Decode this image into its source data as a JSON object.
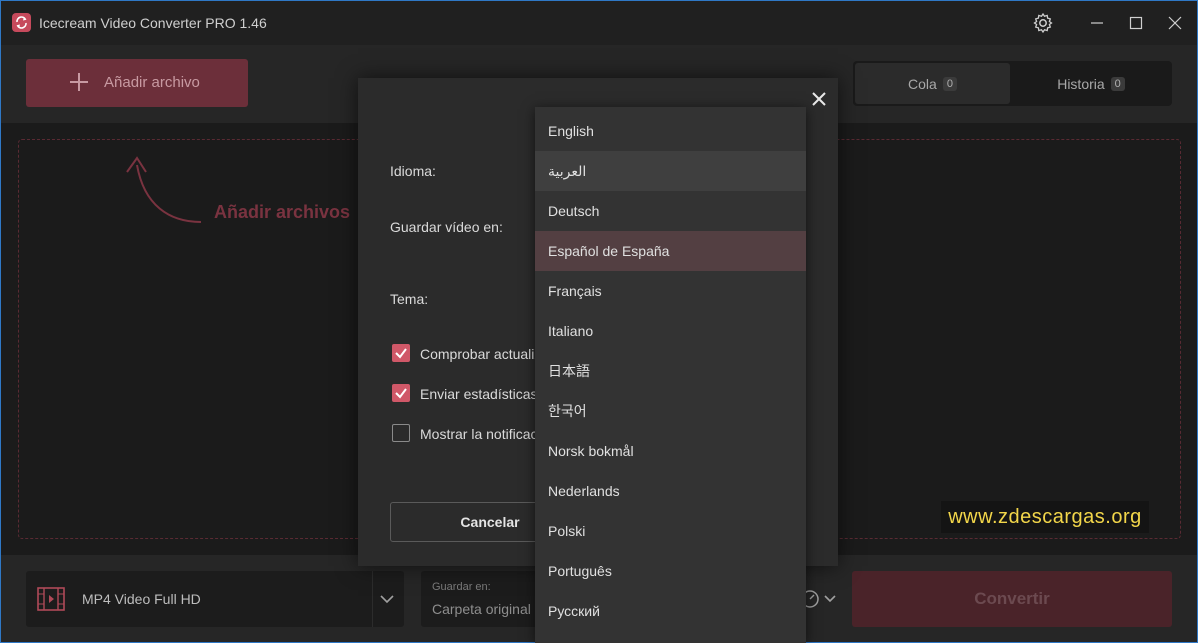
{
  "app": {
    "title": "Icecream Video Converter PRO 1.46"
  },
  "toolbar": {
    "add_file_label": "Añadir archivo"
  },
  "tabs": [
    {
      "label": "Cola",
      "count": "0"
    },
    {
      "label": "Historia",
      "count": "0"
    }
  ],
  "dropzone": {
    "hint": "Añadir archivos"
  },
  "watermark": "www.zdescargas.org",
  "bottom": {
    "format_label": "MP4 Video Full HD",
    "save_to_caption": "Guardar en:",
    "save_to_value": "Carpeta original",
    "convert_label": "Convertir"
  },
  "settings": {
    "language_label": "Idioma:",
    "save_video_label": "Guardar vídeo en:",
    "theme_label": "Tema:",
    "checkboxes": [
      {
        "label": "Comprobar actualiz",
        "checked": true
      },
      {
        "label": "Enviar estadísticas",
        "checked": true
      },
      {
        "label": "Mostrar la notificac",
        "checked": false
      }
    ],
    "cancel_label": "Cancelar"
  },
  "language_menu": {
    "options": [
      "English",
      "العربية",
      "Deutsch",
      "Español de España",
      "Français",
      "Italiano",
      "日本語",
      "한국어",
      "Norsk bokmål",
      "Nederlands",
      "Polski",
      "Português",
      "Русский"
    ],
    "selected": "Español de España",
    "hovered": "العربية"
  },
  "colors": {
    "accent": "#d05868",
    "add_button_bg": "#6c2f3a",
    "watermark_text": "#f2d64a",
    "window_border": "#2f78c6"
  }
}
